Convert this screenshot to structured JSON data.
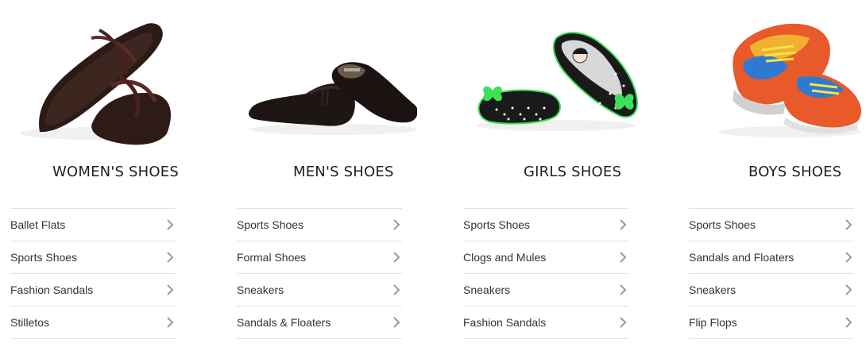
{
  "categories": [
    {
      "title": "WOMEN'S SHOES",
      "image_icon": "women-sandal-image",
      "items": [
        {
          "label": "Ballet Flats"
        },
        {
          "label": "Sports Shoes"
        },
        {
          "label": "Fashion Sandals"
        },
        {
          "label": "Stilletos"
        }
      ]
    },
    {
      "title": "MEN'S SHOES",
      "image_icon": "men-formal-shoe-image",
      "items": [
        {
          "label": "Sports Shoes"
        },
        {
          "label": "Formal Shoes"
        },
        {
          "label": "Sneakers"
        },
        {
          "label": "Sandals & Floaters"
        }
      ]
    },
    {
      "title": "GIRLS SHOES",
      "image_icon": "girls-ballet-flat-image",
      "items": [
        {
          "label": "Sports Shoes"
        },
        {
          "label": "Clogs and Mules"
        },
        {
          "label": "Sneakers"
        },
        {
          "label": "Fashion Sandals"
        }
      ]
    },
    {
      "title": "BOYS SHOES",
      "image_icon": "boys-sneaker-image",
      "items": [
        {
          "label": "Sports Shoes"
        },
        {
          "label": "Sandals and Floaters"
        },
        {
          "label": "Sneakers"
        },
        {
          "label": "Flip Flops"
        }
      ]
    }
  ],
  "icons": {
    "chevron": "chevron-right-icon"
  },
  "colors": {
    "divider": "#e3e3e3",
    "chevron": "#9a9a9a",
    "text": "#333333",
    "title": "#1f1f1f"
  }
}
